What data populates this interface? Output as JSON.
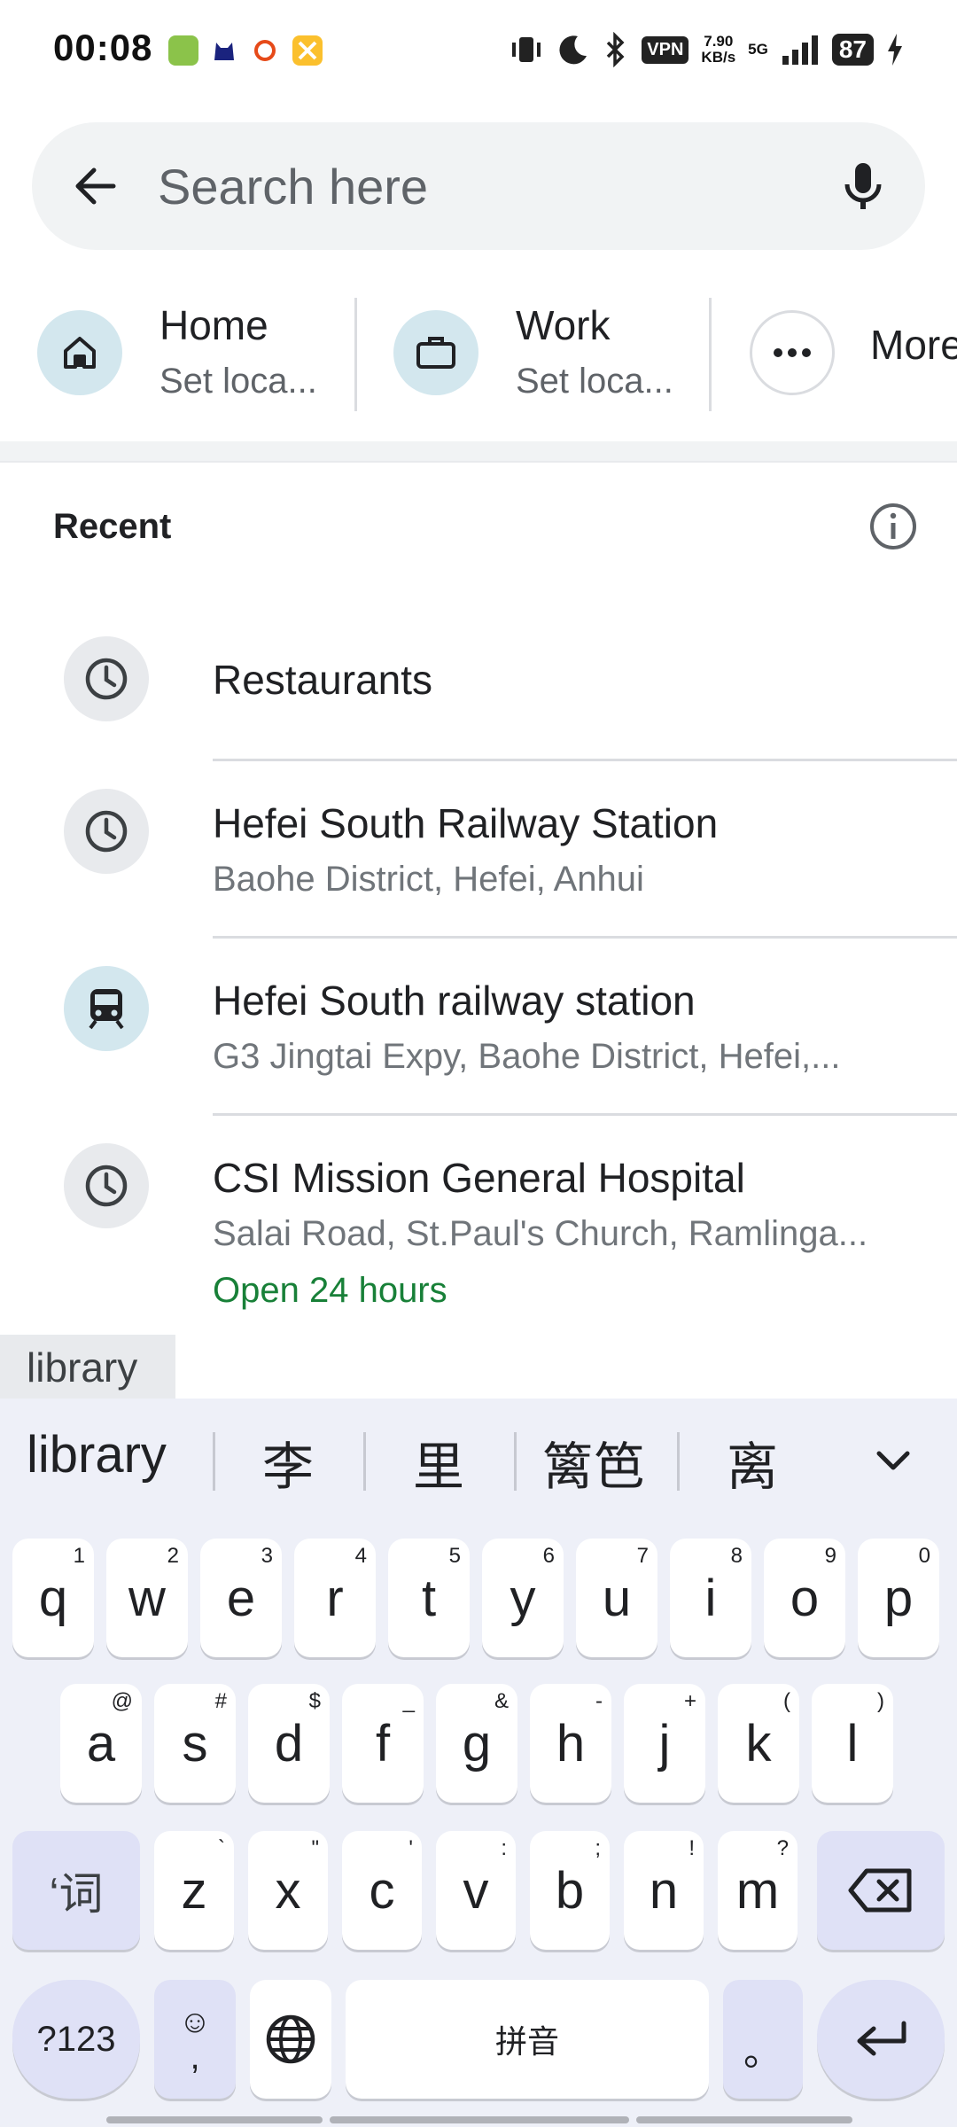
{
  "status_bar": {
    "time": "00:08",
    "vpn": "VPN",
    "speed_value": "7.90",
    "speed_unit": "KB/s",
    "network": "5G",
    "battery": "87"
  },
  "search": {
    "placeholder": "Search here"
  },
  "shortcuts": {
    "home": {
      "title": "Home",
      "subtitle": "Set loca..."
    },
    "work": {
      "title": "Work",
      "subtitle": "Set loca..."
    },
    "more": {
      "title": "More"
    }
  },
  "recent": {
    "header": "Recent",
    "items": [
      {
        "title": "Restaurants",
        "icon": "history-icon"
      },
      {
        "title": "Hefei South Railway Station",
        "subtitle": "Baohe District, Hefei, Anhui",
        "icon": "history-icon"
      },
      {
        "title": "Hefei South railway station",
        "subtitle": "G3 Jingtai Expy, Baohe District, Hefei,...",
        "icon": "train-icon"
      },
      {
        "title": "CSI Mission General Hospital",
        "subtitle": "Salai Road, St.Paul's Church, Ramlinga...",
        "status": "Open 24 hours",
        "icon": "history-icon"
      }
    ]
  },
  "suggestion_chip": "library",
  "keyboard": {
    "candidates": [
      "library",
      "李",
      "里",
      "篱笆",
      "离"
    ],
    "row1": [
      {
        "k": "q",
        "h": "1"
      },
      {
        "k": "w",
        "h": "2"
      },
      {
        "k": "e",
        "h": "3"
      },
      {
        "k": "r",
        "h": "4"
      },
      {
        "k": "t",
        "h": "5"
      },
      {
        "k": "y",
        "h": "6"
      },
      {
        "k": "u",
        "h": "7"
      },
      {
        "k": "i",
        "h": "8"
      },
      {
        "k": "o",
        "h": "9"
      },
      {
        "k": "p",
        "h": "0"
      }
    ],
    "row2": [
      {
        "k": "a",
        "h": "@"
      },
      {
        "k": "s",
        "h": "#"
      },
      {
        "k": "d",
        "h": "$"
      },
      {
        "k": "f",
        "h": "_"
      },
      {
        "k": "g",
        "h": "&"
      },
      {
        "k": "h",
        "h": "-"
      },
      {
        "k": "j",
        "h": "+"
      },
      {
        "k": "k",
        "h": "("
      },
      {
        "k": "l",
        "h": ")"
      }
    ],
    "row3": [
      {
        "k": "z",
        "h": "`"
      },
      {
        "k": "x",
        "h": "\""
      },
      {
        "k": "c",
        "h": "'"
      },
      {
        "k": "v",
        "h": ":"
      },
      {
        "k": "b",
        "h": ";"
      },
      {
        "k": "n",
        "h": "!"
      },
      {
        "k": "m",
        "h": "?"
      }
    ],
    "shift_label": "‘词",
    "symbols_label": "?123",
    "emoji_label": "☺",
    "comma_label": ",",
    "space_label": "拼音",
    "period_label": "。"
  },
  "colors": {
    "accent_light": "#d3e7ee",
    "open_green": "#188038",
    "keyboard_bg": "#eef0f8",
    "func_key": "#dfe1f6"
  }
}
